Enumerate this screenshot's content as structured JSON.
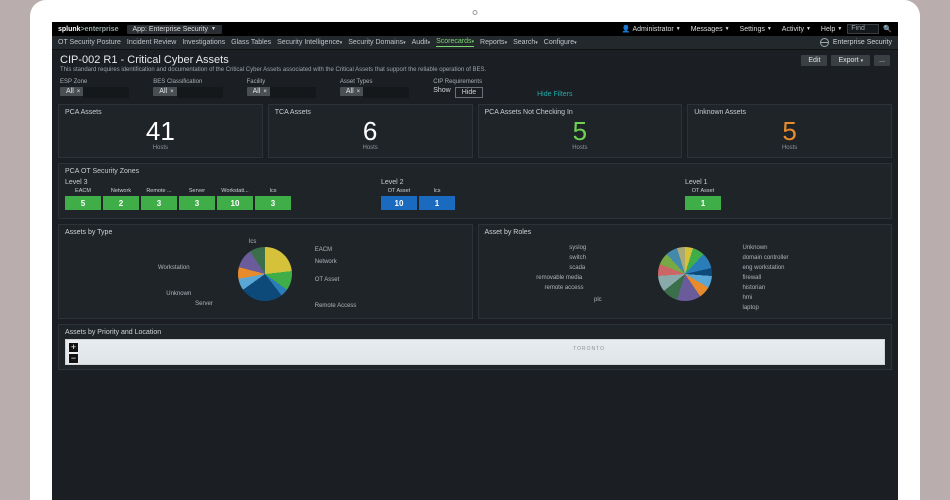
{
  "topbar": {
    "brand_a": "splunk",
    "brand_b": ">enterprise",
    "app_label": "App: Enterprise Security",
    "admin": "Administrator",
    "messages": "Messages",
    "settings": "Settings",
    "activity": "Activity",
    "help": "Help",
    "find": "Find"
  },
  "menu": {
    "ot": "OT Security Posture",
    "incident": "Incident Review",
    "investigations": "Investigations",
    "glass": "Glass Tables",
    "secintel": "Security Intelligence",
    "secdom": "Security Domains",
    "audit": "Audit",
    "scorecards": "Scorecards",
    "reports": "Reports",
    "search": "Search",
    "configure": "Configure",
    "es": "Enterprise Security"
  },
  "title": {
    "main": "CIP-002 R1 - Critical Cyber Assets",
    "sub": "This standard requires identification and documentation of the Critical Cyber Assets associated with the Critical Assets that support the reliable operation of BES.",
    "edit": "Edit",
    "export": "Export",
    "more": "..."
  },
  "filters": {
    "esp": "ESP Zone",
    "bes": "BES Classification",
    "facility": "Facility",
    "asset_types": "Asset Types",
    "cip": "CIP Requirements",
    "all": "All",
    "show": "Show",
    "hide": "Hide",
    "hidefilters": "Hide Filters"
  },
  "metrics": {
    "pca": {
      "title": "PCA Assets",
      "value": "41",
      "unit": "Hosts"
    },
    "tca": {
      "title": "TCA Assets",
      "value": "6",
      "unit": "Hosts"
    },
    "notchk": {
      "title": "PCA Assets Not Checking In",
      "value": "5",
      "unit": "Hosts"
    },
    "unknown": {
      "title": "Unknown Assets",
      "value": "5",
      "unit": "Hosts"
    }
  },
  "zones": {
    "title": "PCA OT Security Zones",
    "level3": {
      "label": "Level 3",
      "items": [
        {
          "name": "EACM",
          "value": "5"
        },
        {
          "name": "Network",
          "value": "2"
        },
        {
          "name": "Remote ...",
          "value": "3"
        },
        {
          "name": "Server",
          "value": "3"
        },
        {
          "name": "Workstati...",
          "value": "10"
        },
        {
          "name": "Ics",
          "value": "3"
        }
      ]
    },
    "level2": {
      "label": "Level 2",
      "items": [
        {
          "name": "OT Asset",
          "value": "10"
        },
        {
          "name": "Ics",
          "value": "1"
        }
      ]
    },
    "level1": {
      "label": "Level 1",
      "items": [
        {
          "name": "OT Asset",
          "value": "1"
        }
      ]
    }
  },
  "pie1": {
    "title": "Assets by Type",
    "labels": {
      "l1": "Workstation",
      "l2": "Unknown",
      "l3": "Server",
      "l4": "Ics",
      "l5": "EACM",
      "l6": "Network",
      "l7": "OT Asset",
      "l8": "Remote Access"
    }
  },
  "pie2": {
    "title": "Asset by Roles",
    "labels": {
      "l1": "syslog",
      "l2": "switch",
      "l3": "scada",
      "l4": "removable media",
      "l5": "remote access",
      "l6": "plc",
      "l7": "Unknown",
      "l8": "domain controller",
      "l9": "eng workstation",
      "l10": "firewall",
      "l11": "historian",
      "l12": "hmi",
      "l13": "laptop"
    }
  },
  "mapsec": {
    "title": "Assets by Priority and Location",
    "toronto": "TORONTO"
  },
  "chart_data": [
    {
      "type": "pie",
      "title": "Assets by Type",
      "series": [
        {
          "name": "Workstation",
          "value": 10
        },
        {
          "name": "EACM",
          "value": 5
        },
        {
          "name": "Network",
          "value": 2
        },
        {
          "name": "OT Asset",
          "value": 11
        },
        {
          "name": "Remote Access",
          "value": 3
        },
        {
          "name": "Server",
          "value": 3
        },
        {
          "name": "Unknown",
          "value": 5
        },
        {
          "name": "Ics",
          "value": 4
        }
      ]
    },
    {
      "type": "pie",
      "title": "Asset by Roles",
      "series": [
        {
          "name": "syslog",
          "value": 2
        },
        {
          "name": "switch",
          "value": 3
        },
        {
          "name": "scada",
          "value": 4
        },
        {
          "name": "removable media",
          "value": 2
        },
        {
          "name": "remote access",
          "value": 3
        },
        {
          "name": "plc",
          "value": 3
        },
        {
          "name": "Unknown",
          "value": 6
        },
        {
          "name": "domain controller",
          "value": 4
        },
        {
          "name": "eng workstation",
          "value": 4
        },
        {
          "name": "firewall",
          "value": 3
        },
        {
          "name": "historian",
          "value": 3
        },
        {
          "name": "hmi",
          "value": 3
        },
        {
          "name": "laptop",
          "value": 2
        }
      ]
    }
  ]
}
